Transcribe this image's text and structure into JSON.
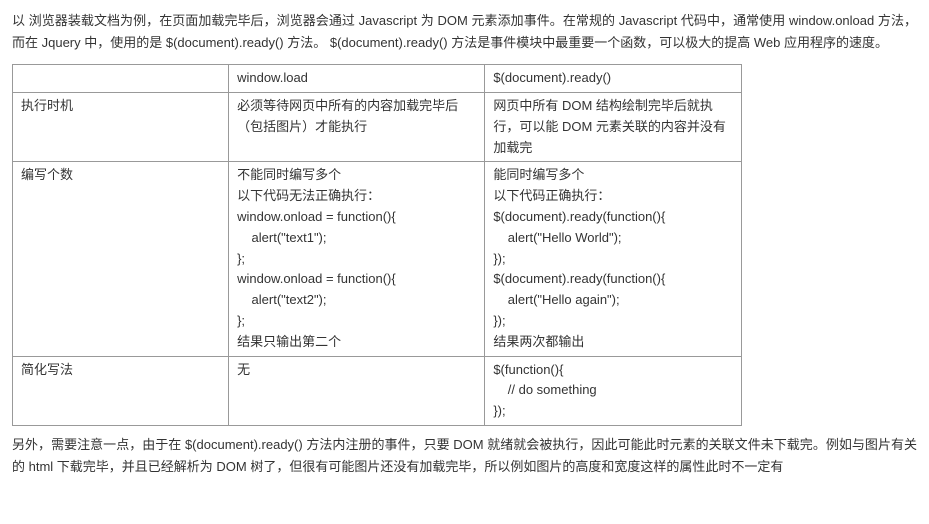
{
  "intro": "以 浏览器装载文档为例，在页面加载完毕后，浏览器会通过 Javascript 为 DOM 元素添加事件。在常规的 Javascript 代码中，通常使用 window.onload 方法，而在 Jquery 中，使用的是 $(document).ready() 方法。  $(document).ready() 方法是事件模块中最重要一个函数，可以极大的提高 Web 应用程序的速度。",
  "table": {
    "header": {
      "col1": "",
      "col2": "window.load",
      "col3": "$(document).ready()"
    },
    "row1": {
      "col1": "执行时机",
      "col2": "必须等待网页中所有的内容加载完毕后（包括图片）才能执行",
      "col3": "网页中所有 DOM 结构绘制完毕后就执行，可以能 DOM 元素关联的内容并没有加载完"
    },
    "row2": {
      "col1": "编写个数",
      "col2_line1": "不能同时编写多个",
      "col2_line2": "以下代码无法正确执行：",
      "col2_line3": "window.onload = function(){",
      "col2_line4": "    alert(\"text1\");",
      "col2_line5": "};",
      "col2_line6": "window.onload = function(){",
      "col2_line7": "    alert(\"text2\");",
      "col2_line8": "};",
      "col2_line9": "结果只输出第二个",
      "col3_line1": "能同时编写多个",
      "col3_line2": "以下代码正确执行：",
      "col3_line3": "$(document).ready(function(){",
      "col3_line4": "    alert(\"Hello World\");",
      "col3_line5": "});",
      "col3_line6": "$(document).ready(function(){",
      "col3_line7": "    alert(\"Hello again\");",
      "col3_line8": "});",
      "col3_line9": "结果两次都输出"
    },
    "row3": {
      "col1": "简化写法",
      "col2": "无",
      "col3_line1": "$(function(){",
      "col3_line2": "    // do something",
      "col3_line3": "});"
    }
  },
  "outro": "另外，需要注意一点，由于在 $(document).ready() 方法内注册的事件，只要 DOM 就绪就会被执行，因此可能此时元素的关联文件未下载完。例如与图片有关的 html 下载完毕，并且已经解析为 DOM 树了，但很有可能图片还没有加载完毕，所以例如图片的高度和宽度这样的属性此时不一定有"
}
